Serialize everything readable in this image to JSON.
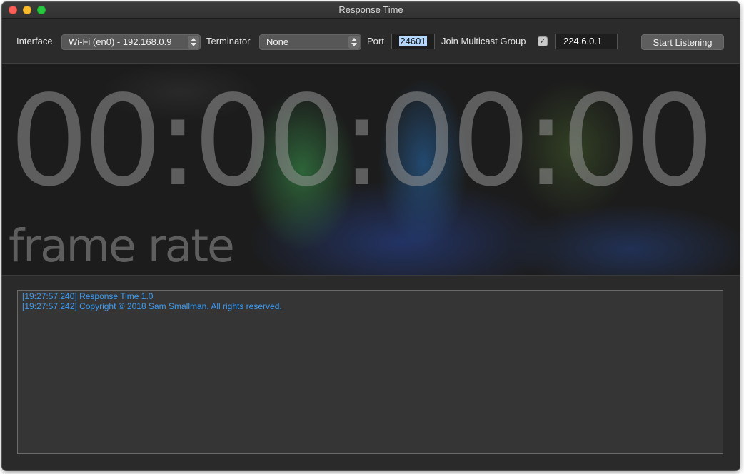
{
  "window": {
    "title": "Response Time"
  },
  "toolbar": {
    "interface_label": "Interface",
    "interface_value": "Wi-Fi (en0) - 192.168.0.9",
    "terminator_label": "Terminator",
    "terminator_value": "None",
    "port_label": "Port",
    "port_value": "24601",
    "multicast_label": "Join Multicast Group",
    "multicast_checked": true,
    "multicast_check_glyph": "✓",
    "multicast_address": "224.6.0.1",
    "start_button_label": "Start Listening"
  },
  "display": {
    "timecode": "00:00:00:00",
    "frame_rate_label": "frame rate"
  },
  "log": {
    "lines": [
      "[19:27:57.240] Response Time 1.0",
      "[19:27:57.242] Copyright © 2018 Sam Smallman. All rights reserved."
    ]
  },
  "colors": {
    "log_text": "#3a9bf3",
    "window_background": "#2a2a2a",
    "selection_highlight": "#b3d7ff"
  },
  "icons": {
    "close": "close-traffic-light-icon",
    "minimize": "minimize-traffic-light-icon",
    "zoom": "zoom-traffic-light-icon",
    "popup_stepper": "chevron-up-down-icon",
    "checkbox": "checkmark-icon"
  }
}
